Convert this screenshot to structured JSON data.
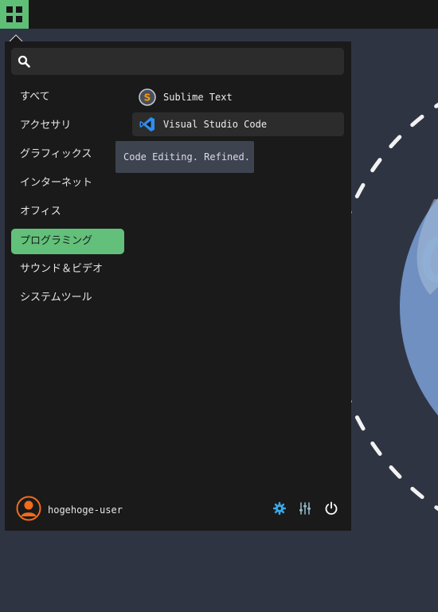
{
  "search": {
    "placeholder": "",
    "value": ""
  },
  "categories": [
    {
      "label": "すべて"
    },
    {
      "label": "アクセサリ"
    },
    {
      "label": "グラフィックス"
    },
    {
      "label": "インターネット"
    },
    {
      "label": "オフィス"
    },
    {
      "label": "プログラミング",
      "active": true
    },
    {
      "label": "サウンド＆ビデオ"
    },
    {
      "label": "システムツール"
    }
  ],
  "apps": [
    {
      "label": "Sublime Text",
      "icon": "sublime-text-icon"
    },
    {
      "label": "Visual Studio Code",
      "icon": "vscode-icon",
      "hovered": true
    }
  ],
  "tooltip": {
    "text": "Code Editing. Refined."
  },
  "footer": {
    "username": "hogehoge-user",
    "buttons": [
      "settings-gear-icon",
      "mixer-sliders-icon",
      "power-icon"
    ]
  },
  "colors": {
    "accent": "#62c07a",
    "menu_bg": "#1a1a1a",
    "panel_bg": "#181818",
    "desktop_bg": "#2f3443",
    "avatar": "#f26b1d",
    "gear": "#3aa9e8"
  }
}
